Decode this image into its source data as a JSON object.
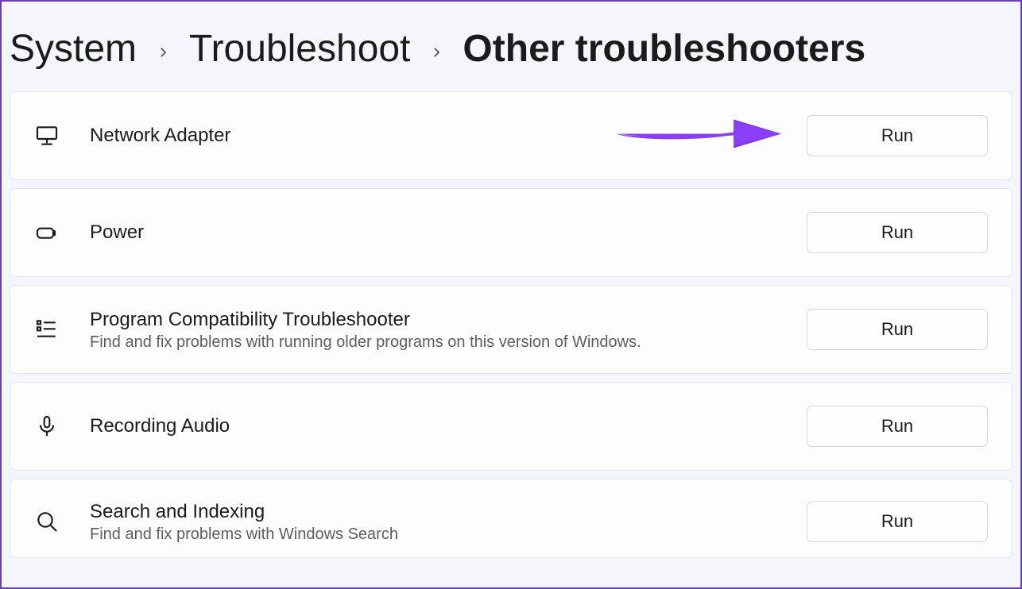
{
  "breadcrumb": {
    "items": [
      {
        "label": "System"
      },
      {
        "label": "Troubleshoot"
      },
      {
        "label": "Other troubleshooters",
        "current": true
      }
    ]
  },
  "buttons": {
    "run": "Run"
  },
  "troubleshooters": [
    {
      "id": "network-adapter",
      "icon": "monitor-stand-icon",
      "title": "Network Adapter",
      "description": "",
      "annotated": true
    },
    {
      "id": "power",
      "icon": "battery-icon",
      "title": "Power",
      "description": ""
    },
    {
      "id": "program-compatibility",
      "icon": "compat-list-icon",
      "title": "Program Compatibility Troubleshooter",
      "description": "Find and fix problems with running older programs on this version of Windows."
    },
    {
      "id": "recording-audio",
      "icon": "microphone-icon",
      "title": "Recording Audio",
      "description": ""
    },
    {
      "id": "search-indexing",
      "icon": "search-icon",
      "title": "Search and Indexing",
      "description": "Find and fix problems with Windows Search"
    }
  ],
  "annotation": {
    "color": "#8a3ffc"
  }
}
